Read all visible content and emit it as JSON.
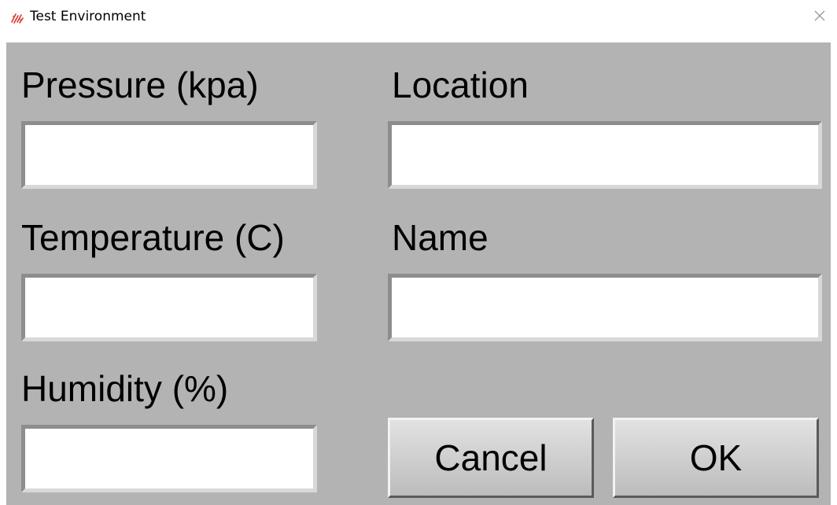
{
  "window": {
    "title": "Test Environment",
    "icon": "app-logo-icon",
    "close_icon": "close-icon"
  },
  "form": {
    "pressure": {
      "label": "Pressure (kpa)",
      "value": ""
    },
    "temperature": {
      "label": "Temperature (C)",
      "value": ""
    },
    "humidity": {
      "label": "Humidity (%)",
      "value": ""
    },
    "location": {
      "label": "Location",
      "value": ""
    },
    "name": {
      "label": "Name",
      "value": ""
    }
  },
  "buttons": {
    "cancel": "Cancel",
    "ok": "OK"
  },
  "colors": {
    "client_background": "#b3b3b3",
    "field_background": "#ffffff"
  }
}
